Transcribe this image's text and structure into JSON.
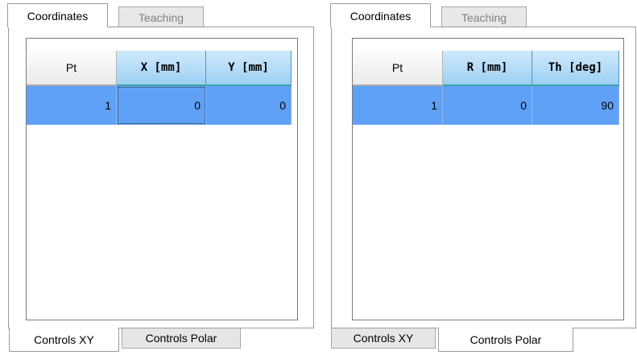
{
  "panels": [
    {
      "top_tabs": [
        {
          "label": "Coordinates",
          "active": true
        },
        {
          "label": "Teaching",
          "active": false
        }
      ],
      "grid": {
        "headers": [
          "Pt",
          "X [mm]",
          "Y [mm]"
        ],
        "rows": [
          [
            "1",
            "0",
            "0"
          ]
        ]
      },
      "bottom_tabs": [
        {
          "label": "Controls XY",
          "active": true
        },
        {
          "label": "Controls Polar",
          "active": false
        }
      ]
    },
    {
      "top_tabs": [
        {
          "label": "Coordinates",
          "active": true
        },
        {
          "label": "Teaching",
          "active": false
        }
      ],
      "grid": {
        "headers": [
          "Pt",
          "R [mm]",
          "Th [deg]"
        ],
        "rows": [
          [
            "1",
            "0",
            "90"
          ]
        ]
      },
      "bottom_tabs": [
        {
          "label": "Controls XY",
          "active": false
        },
        {
          "label": "Controls Polar",
          "active": true
        }
      ]
    }
  ],
  "colors": {
    "selected_row": "#5fa1f7",
    "selected_header": "#9dd0f4"
  }
}
